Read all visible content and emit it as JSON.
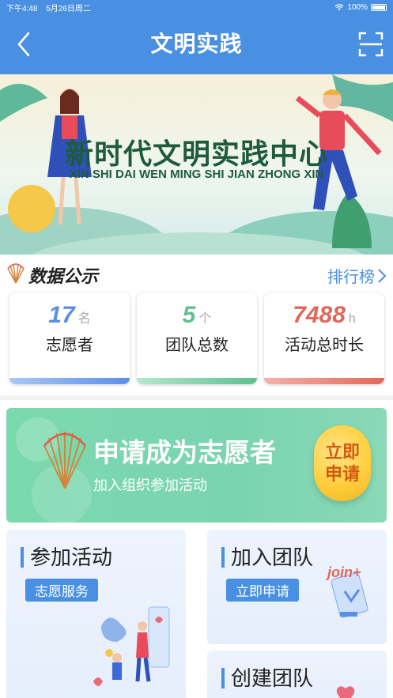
{
  "status": {
    "time": "下午4:48",
    "date": "5月26日周二",
    "battery": "100%"
  },
  "nav": {
    "title": "文明实践"
  },
  "banner": {
    "title": "新时代文明实践中心",
    "subtitle": "XIN SHI DAI WEN MING SHI JIAN ZHONG XIN"
  },
  "data_section": {
    "title": "数据公示",
    "rank_label": "排行榜"
  },
  "stats": [
    {
      "value": "17",
      "unit": "名",
      "label": "志愿者",
      "color": "#5b8fe6"
    },
    {
      "value": "5",
      "unit": "个",
      "label": "团队总数",
      "color": "#5fbf8e"
    },
    {
      "value": "7488",
      "unit": "h",
      "label": "活动总时长",
      "color": "#e0675a"
    }
  ],
  "volunteer": {
    "title": "申请成为志愿者",
    "subtitle": "加入组织参加活动",
    "button_line1": "立即",
    "button_line2": "申请"
  },
  "tiles": {
    "join_activity": {
      "title": "参加活动",
      "tag": "志愿服务"
    },
    "join_team": {
      "title": "加入团队",
      "tag": "立即申请",
      "join_text": "join+"
    },
    "create_team": {
      "title": "创建团队"
    }
  },
  "colors": {
    "primary": "#4a90e2",
    "green_card": "#7ad4b0",
    "apply_btn": "#ffcf3e"
  }
}
